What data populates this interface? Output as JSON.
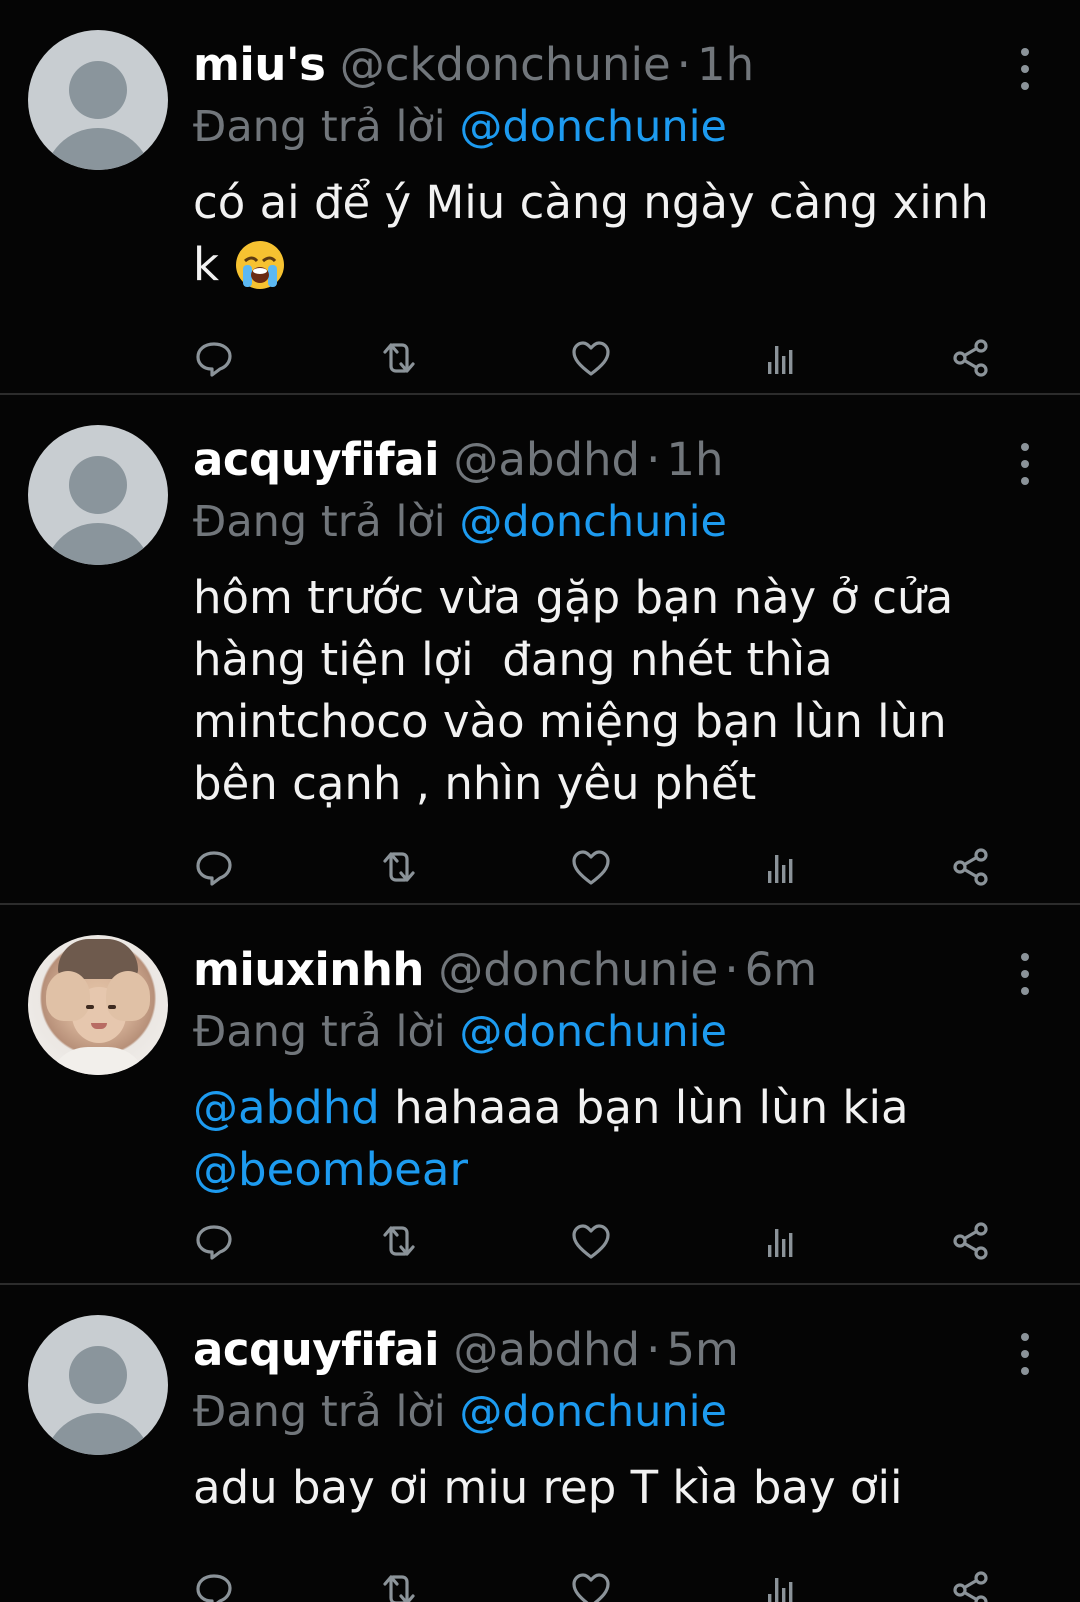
{
  "theme": {
    "background": "#050505",
    "text": "#f2f2f2",
    "muted": "#71767b",
    "link": "#1d9bf0",
    "divider": "#2c2c2c"
  },
  "tweets": [
    {
      "name": "miu's",
      "handle": "@ckdonchunie",
      "time": "1h",
      "reply_label": "Đang trả lời",
      "reply_to": "@donchunie",
      "text_mention": "",
      "text": "có ai để ý Miu càng ngày càng xinh\nk",
      "text_emoji": "loudly-crying-face-emoji",
      "text_mention_after": "",
      "avatar": "default-avatar"
    },
    {
      "name": "acquyfifai",
      "handle": "@abdhd",
      "time": "1h",
      "reply_label": "Đang trả lời",
      "reply_to": "@donchunie",
      "text_mention": "",
      "text": "hôm trước vừa gặp bạn này ở cửa\nhàng tiện lợi  đang nhét thìa\nmintchoco vào miệng bạn lùn lùn\nbên cạnh , nhìn yêu phết",
      "text_mention_after": "",
      "avatar": "default-avatar"
    },
    {
      "name": "miuxinhh",
      "handle": "@donchunie",
      "time": "6m",
      "reply_label": "Đang trả lời",
      "reply_to": "@donchunie",
      "text_mention": "@abdhd",
      "text": " hahaaa bạn lùn lùn kia",
      "text_mention_after": "@beombear",
      "avatar": "photo-avatar"
    },
    {
      "name": "acquyfifai",
      "handle": "@abdhd",
      "time": "5m",
      "reply_label": "Đang trả lời",
      "reply_to": "@donchunie",
      "text_mention": "",
      "text": "adu bay ơi miu rep T kìa bay ơii",
      "text_mention_after": "",
      "avatar": "default-avatar"
    }
  ],
  "action_icons": [
    "reply-icon",
    "retweet-icon",
    "like-icon",
    "views-icon",
    "share-icon"
  ],
  "more_icon": "more-options-icon",
  "separator": "·"
}
